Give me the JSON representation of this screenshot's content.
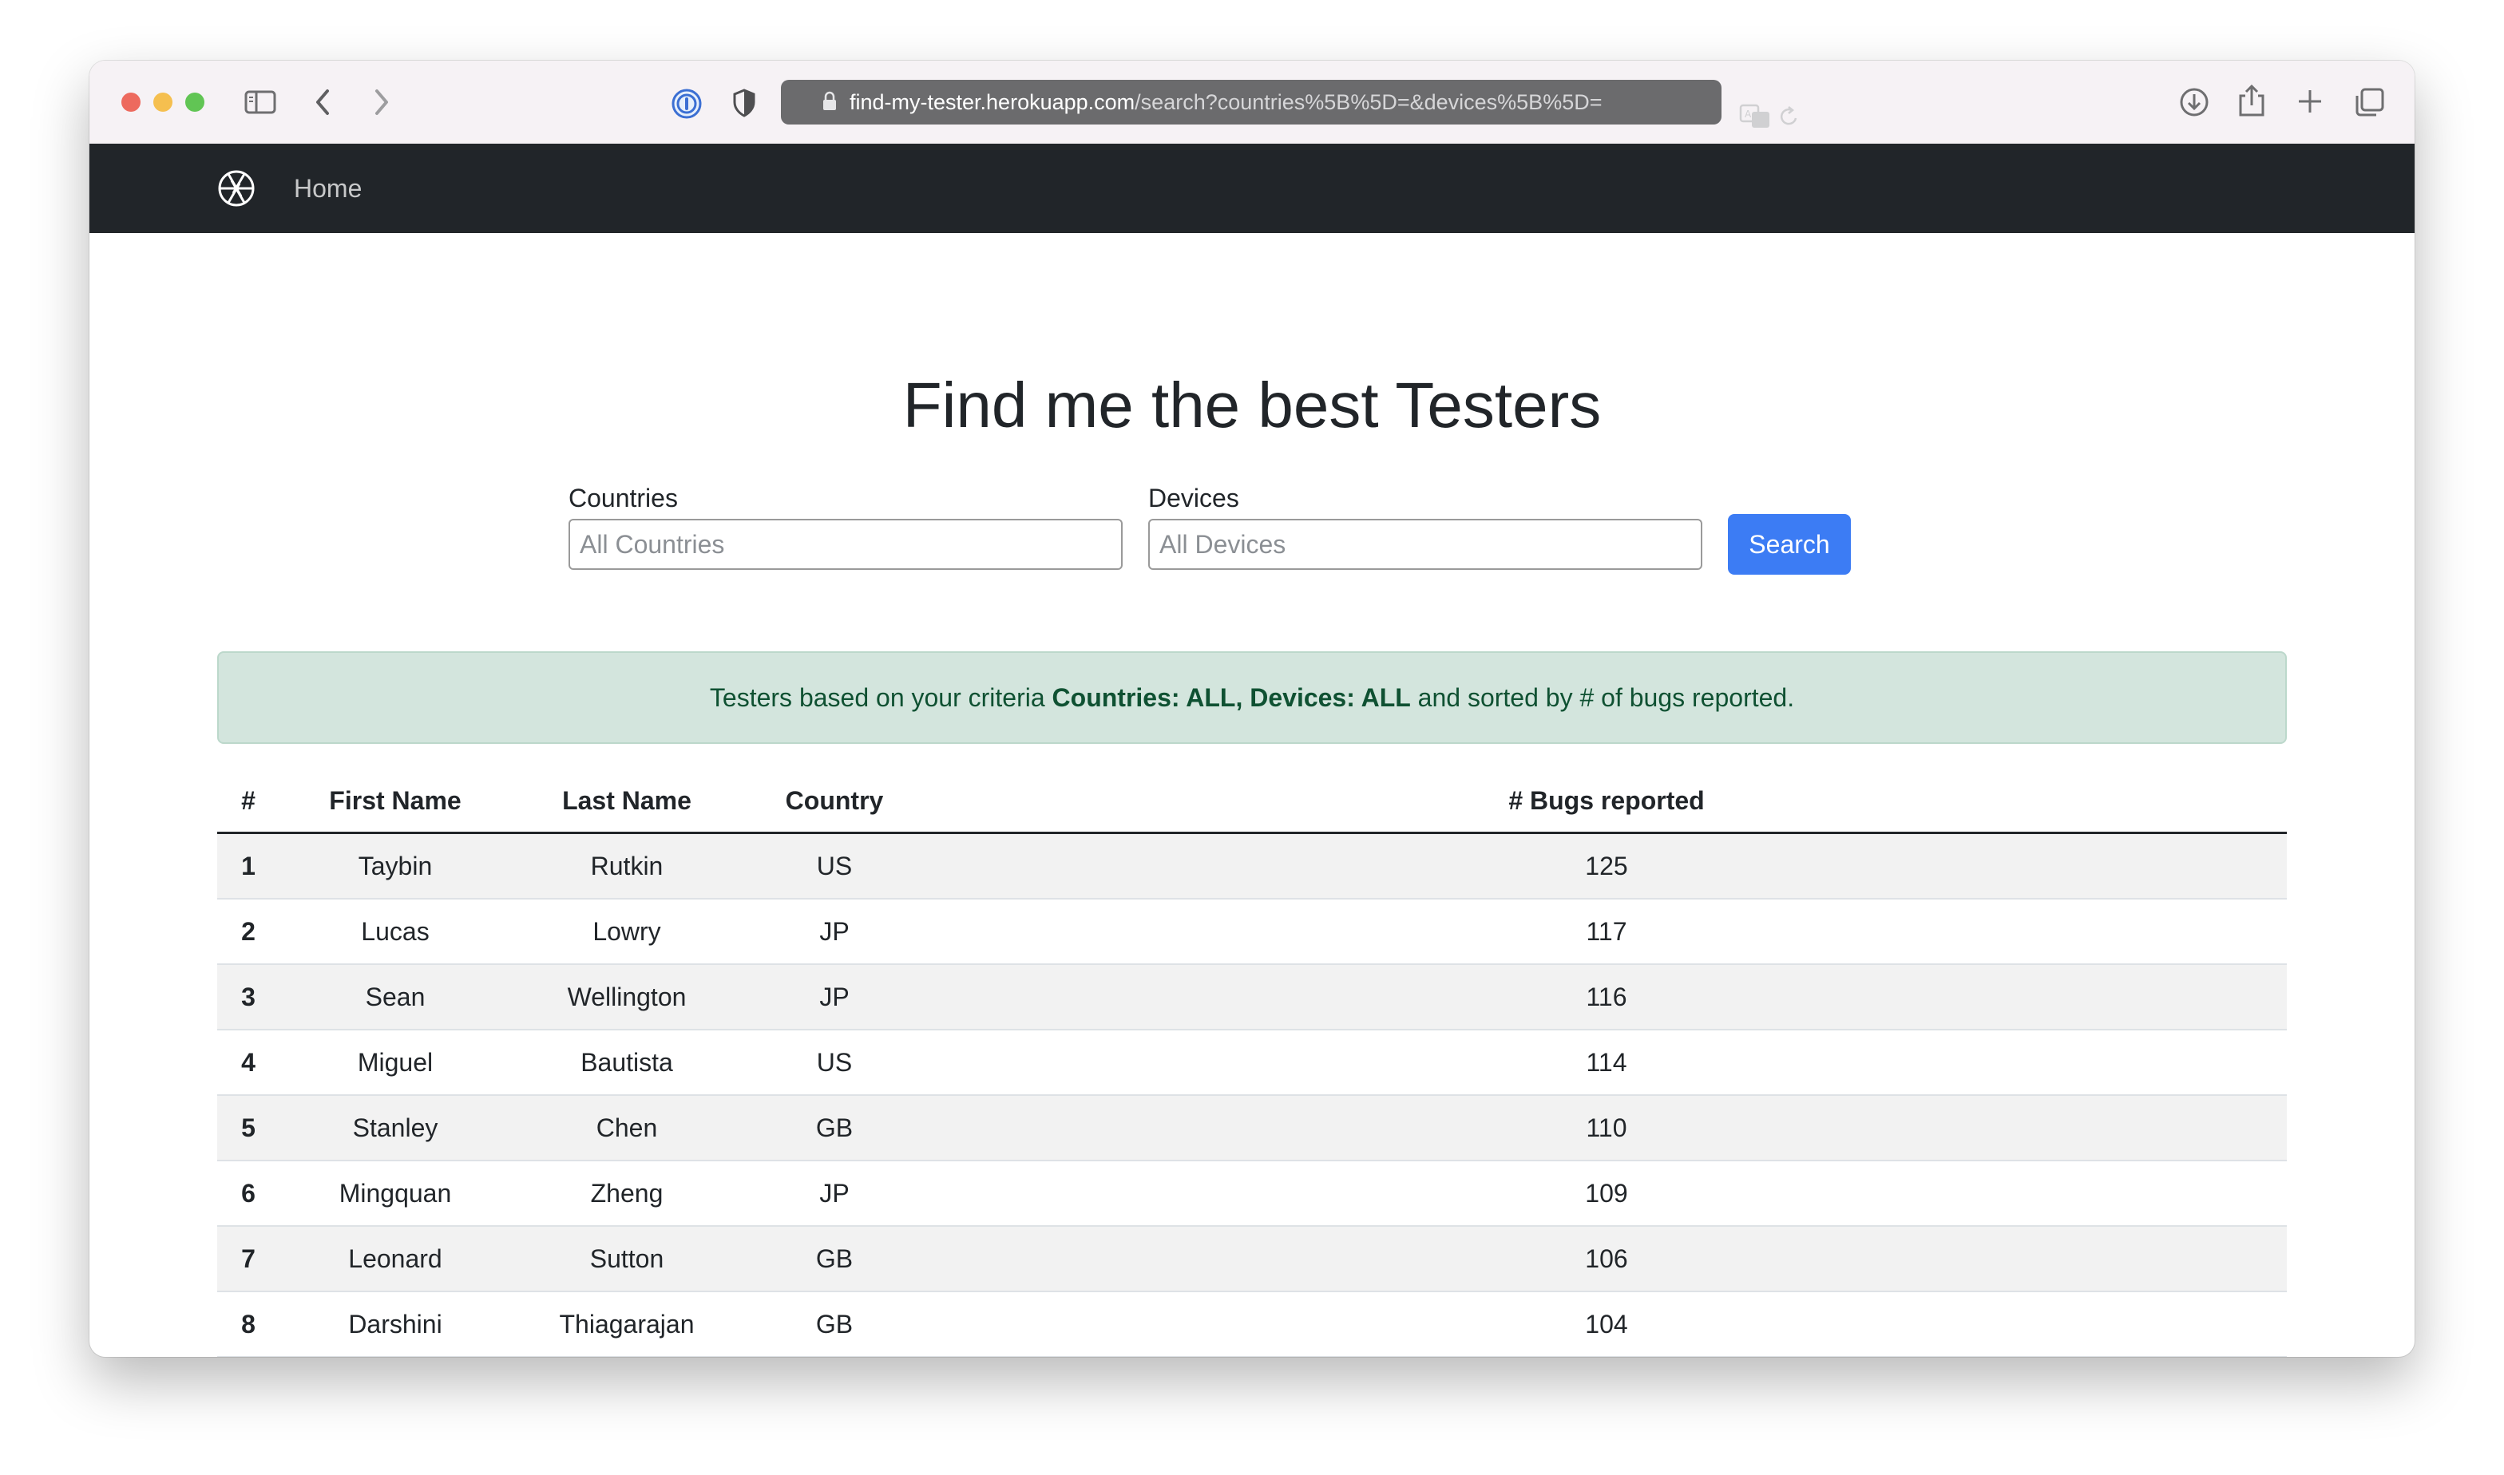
{
  "browser": {
    "url_host": "find-my-tester.herokuapp.com",
    "url_path": "/search?countries%5B%5D=&devices%5B%5D="
  },
  "navbar": {
    "brand_icon": "aperture-icon",
    "home_label": "Home"
  },
  "page": {
    "title": "Find me the best Testers"
  },
  "form": {
    "countries_label": "Countries",
    "countries_placeholder": "All Countries",
    "countries_value": "",
    "devices_label": "Devices",
    "devices_placeholder": "All Devices",
    "devices_value": "",
    "search_label": "Search"
  },
  "alert": {
    "prefix": "Testers based on your criteria ",
    "criteria": "Countries: ALL, Devices: ALL",
    "suffix": " and sorted by # of bugs reported."
  },
  "table": {
    "headers": [
      "#",
      "First Name",
      "Last Name",
      "Country",
      "# Bugs reported"
    ],
    "rows": [
      {
        "rank": "1",
        "first": "Taybin",
        "last": "Rutkin",
        "country": "US",
        "bugs": "125"
      },
      {
        "rank": "2",
        "first": "Lucas",
        "last": "Lowry",
        "country": "JP",
        "bugs": "117"
      },
      {
        "rank": "3",
        "first": "Sean",
        "last": "Wellington",
        "country": "JP",
        "bugs": "116"
      },
      {
        "rank": "4",
        "first": "Miguel",
        "last": "Bautista",
        "country": "US",
        "bugs": "114"
      },
      {
        "rank": "5",
        "first": "Stanley",
        "last": "Chen",
        "country": "GB",
        "bugs": "110"
      },
      {
        "rank": "6",
        "first": "Mingquan",
        "last": "Zheng",
        "country": "JP",
        "bugs": "109"
      },
      {
        "rank": "7",
        "first": "Leonard",
        "last": "Sutton",
        "country": "GB",
        "bugs": "106"
      },
      {
        "rank": "8",
        "first": "Darshini",
        "last": "Thiagarajan",
        "country": "GB",
        "bugs": "104"
      }
    ]
  },
  "colors": {
    "navbar_bg": "#212529",
    "primary": "#3c7cf4",
    "alert_bg": "#d3e5dd",
    "alert_text": "#0f5132"
  }
}
